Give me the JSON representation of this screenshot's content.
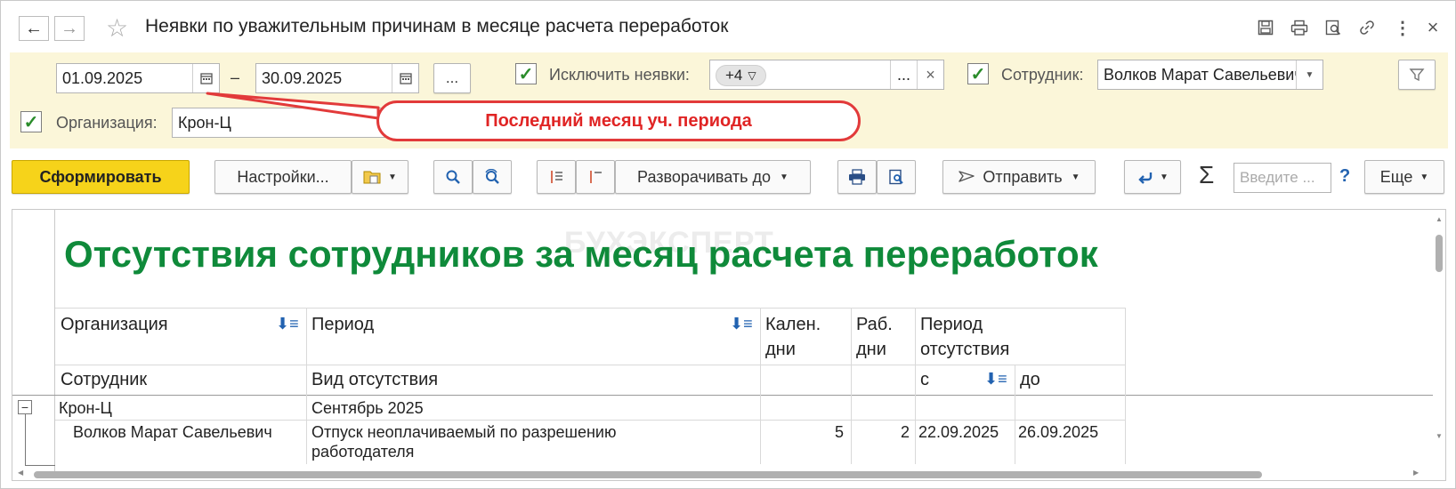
{
  "window": {
    "title": "Неявки по уважительным причинам в месяце расчета переработок",
    "back": "←",
    "forward": "→",
    "star": "☆",
    "close": "×",
    "more": "⋮",
    "icons": [
      "save-icon",
      "print-icon",
      "preview-icon",
      "link-icon"
    ]
  },
  "filters": {
    "date_from": "01.09.2025",
    "date_to": "30.09.2025",
    "dash": "–",
    "period_button": "...",
    "exclude_label": "Исключить неявки:",
    "exclude_tag": "+4",
    "exclude_more": "...",
    "exclude_clear": "×",
    "employee_label": "Сотрудник:",
    "employee_value": "Волков Марат Савельевич",
    "org_label": "Организация:",
    "org_value": "Крон-Ц",
    "check": "✓"
  },
  "callout": {
    "text": "Последний месяц уч. периода"
  },
  "toolbar": {
    "generate": "Сформировать",
    "settings": "Настройки...",
    "expand_to": "Разворачивать до",
    "send": "Отправить",
    "sigma": "Σ",
    "search_placeholder": "Введите ...",
    "help": "?",
    "more": "Еще"
  },
  "report": {
    "watermark": "БУХЭКСПЕРТ",
    "title": "Отсутствия сотрудников за месяц расчета переработок",
    "headers": {
      "org": "Организация",
      "period": "Период",
      "cal_days_1": "Кален.",
      "cal_days_2": "дни",
      "work_days_1": "Раб.",
      "work_days_2": "дни",
      "absence_period_1": "Период",
      "absence_period_2": "отсутствия",
      "employee": "Сотрудник",
      "absence_type": "Вид отсутствия",
      "from": "с",
      "to": "до"
    },
    "group_row": {
      "org": "Крон-Ц",
      "period": "Сентябрь 2025"
    },
    "detail_row": {
      "employee": "Волков Марат Савельевич",
      "type_1": "Отпуск неоплачиваемый по разрешению",
      "type_2": "работодателя",
      "cal_days": "5",
      "work_days": "2",
      "from": "22.09.2025",
      "to": "26.09.2025"
    },
    "collapse": "−"
  },
  "colors": {
    "accent_green": "#0f8a3a",
    "callout_red": "#e23a3a",
    "primary_yellow": "#f6d31a",
    "filter_bg": "#fbf6d9"
  }
}
